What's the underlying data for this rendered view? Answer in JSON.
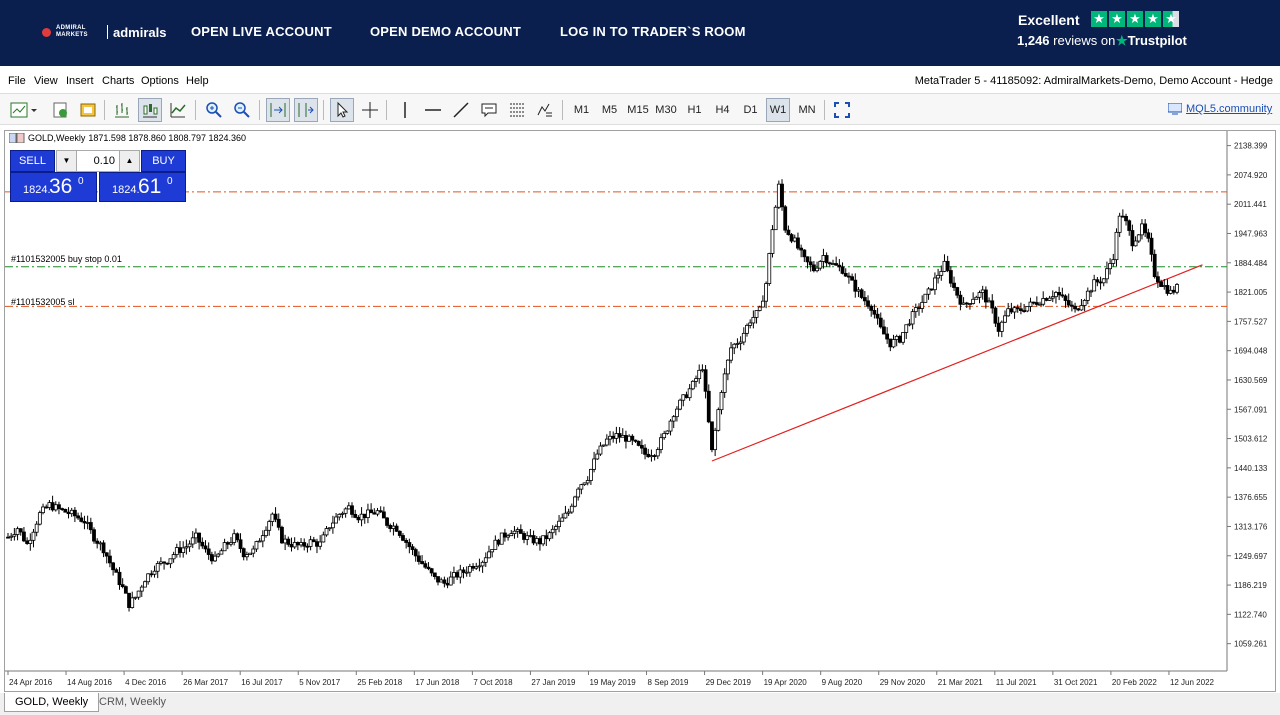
{
  "banner": {
    "logo_text_small": "ADMIRAL MARKETS",
    "logo_text": "admirals",
    "links": [
      "OPEN LIVE ACCOUNT",
      "OPEN DEMO ACCOUNT",
      "LOG IN TO TRADER`S ROOM"
    ],
    "trustpilot": {
      "rating_word": "Excellent",
      "reviews_count": "1,246",
      "reviews_word": "reviews on",
      "brand": "Trustpilot",
      "stars": 4.5
    },
    "colors": {
      "background": "#0b1f4f",
      "trustpilot_green": "#00b67a"
    }
  },
  "menu": {
    "items": [
      "File",
      "View",
      "Insert",
      "Charts",
      "Options",
      "Help"
    ],
    "window_title": "MetaTrader 5 - 41185092: AdmiralMarkets-Demo, Demo Account - Hedge"
  },
  "toolbar": {
    "timeframes": [
      "M1",
      "M5",
      "M15",
      "M30",
      "H1",
      "H4",
      "D1",
      "W1",
      "MN"
    ],
    "active_timeframe": "W1",
    "community_link": "MQL5.community"
  },
  "chart": {
    "symbol_header": "GOLD,Weekly",
    "ohlc_header": "1871.598 1878.860 1808.797 1824.360",
    "trade_panel": {
      "sell_label": "SELL",
      "buy_label": "BUY",
      "volume": "0.10",
      "sell_price_prefix": "1824.",
      "sell_price_big": "36",
      "sell_price_sup": "0",
      "buy_price_prefix": "1824.",
      "buy_price_big": "61",
      "buy_price_sup": "0"
    },
    "level_labels": {
      "buy_stop": "#1101532005 buy stop 0.01",
      "sl": "#1101532005 sl"
    }
  },
  "chart_data": {
    "type": "candlestick",
    "symbol": "GOLD",
    "timeframe": "Weekly",
    "yticks": [
      "2138.399",
      "2074.920",
      "2011.441",
      "1947.963",
      "1884.484",
      "1821.005",
      "1757.527",
      "1694.048",
      "1630.569",
      "1567.091",
      "1503.612",
      "1440.133",
      "1376.655",
      "1313.176",
      "1249.697",
      "1186.219",
      "1122.740",
      "1059.261"
    ],
    "ylim": [
      1000,
      2170
    ],
    "xticks": [
      "24 Apr 2016",
      "14 Aug 2016",
      "4 Dec 2016",
      "26 Mar 2017",
      "16 Jul 2017",
      "5 Nov 2017",
      "25 Feb 2018",
      "17 Jun 2018",
      "7 Oct 2018",
      "27 Jan 2019",
      "19 May 2019",
      "8 Sep 2019",
      "29 Dec 2019",
      "19 Apr 2020",
      "9 Aug 2020",
      "29 Nov 2020",
      "21 Mar 2021",
      "11 Jul 2021",
      "31 Oct 2021",
      "20 Feb 2022",
      "12 Jun 2022"
    ],
    "price_path": [
      [
        0,
        1290
      ],
      [
        3,
        1310
      ],
      [
        6,
        1275
      ],
      [
        10,
        1340
      ],
      [
        13,
        1360
      ],
      [
        16,
        1350
      ],
      [
        20,
        1340
      ],
      [
        24,
        1325
      ],
      [
        27,
        1290
      ],
      [
        30,
        1265
      ],
      [
        33,
        1220
      ],
      [
        36,
        1180
      ],
      [
        38,
        1145
      ],
      [
        40,
        1160
      ],
      [
        43,
        1200
      ],
      [
        46,
        1225
      ],
      [
        50,
        1240
      ],
      [
        53,
        1260
      ],
      [
        56,
        1270
      ],
      [
        59,
        1290
      ],
      [
        62,
        1260
      ],
      [
        65,
        1240
      ],
      [
        68,
        1270
      ],
      [
        71,
        1290
      ],
      [
        74,
        1255
      ],
      [
        77,
        1260
      ],
      [
        80,
        1300
      ],
      [
        83,
        1340
      ],
      [
        86,
        1285
      ],
      [
        89,
        1275
      ],
      [
        92,
        1270
      ],
      [
        95,
        1280
      ],
      [
        98,
        1275
      ],
      [
        101,
        1315
      ],
      [
        104,
        1340
      ],
      [
        107,
        1355
      ],
      [
        110,
        1335
      ],
      [
        113,
        1340
      ],
      [
        116,
        1345
      ],
      [
        119,
        1320
      ],
      [
        122,
        1310
      ],
      [
        125,
        1280
      ],
      [
        128,
        1250
      ],
      [
        131,
        1225
      ],
      [
        134,
        1200
      ],
      [
        137,
        1190
      ],
      [
        140,
        1205
      ],
      [
        143,
        1215
      ],
      [
        146,
        1230
      ],
      [
        149,
        1240
      ],
      [
        152,
        1270
      ],
      [
        155,
        1290
      ],
      [
        158,
        1305
      ],
      [
        161,
        1295
      ],
      [
        164,
        1285
      ],
      [
        167,
        1280
      ],
      [
        170,
        1295
      ],
      [
        173,
        1320
      ],
      [
        176,
        1345
      ],
      [
        179,
        1400
      ],
      [
        182,
        1420
      ],
      [
        185,
        1470
      ],
      [
        188,
        1500
      ],
      [
        191,
        1510
      ],
      [
        194,
        1505
      ],
      [
        197,
        1490
      ],
      [
        200,
        1470
      ],
      [
        203,
        1475
      ],
      [
        206,
        1510
      ],
      [
        209,
        1560
      ],
      [
        212,
        1590
      ],
      [
        215,
        1620
      ],
      [
        218,
        1660
      ],
      [
        221,
        1475
      ],
      [
        224,
        1610
      ],
      [
        227,
        1700
      ],
      [
        230,
        1720
      ],
      [
        233,
        1760
      ],
      [
        236,
        1780
      ],
      [
        238,
        1840
      ],
      [
        240,
        1960
      ],
      [
        242,
        2050
      ],
      [
        244,
        1960
      ],
      [
        247,
        1930
      ],
      [
        250,
        1890
      ],
      [
        253,
        1870
      ],
      [
        256,
        1900
      ],
      [
        259,
        1880
      ],
      [
        262,
        1870
      ],
      [
        265,
        1840
      ],
      [
        268,
        1810
      ],
      [
        271,
        1790
      ],
      [
        274,
        1740
      ],
      [
        277,
        1710
      ],
      [
        280,
        1720
      ],
      [
        283,
        1760
      ],
      [
        286,
        1790
      ],
      [
        289,
        1820
      ],
      [
        292,
        1860
      ],
      [
        294,
        1880
      ],
      [
        297,
        1830
      ],
      [
        300,
        1790
      ],
      [
        303,
        1810
      ],
      [
        306,
        1820
      ],
      [
        309,
        1780
      ],
      [
        311,
        1740
      ],
      [
        314,
        1780
      ],
      [
        317,
        1780
      ],
      [
        320,
        1790
      ],
      [
        323,
        1800
      ],
      [
        326,
        1810
      ],
      [
        329,
        1820
      ],
      [
        332,
        1800
      ],
      [
        335,
        1780
      ],
      [
        338,
        1810
      ],
      [
        341,
        1840
      ],
      [
        344,
        1850
      ],
      [
        347,
        1900
      ],
      [
        349,
        1990
      ],
      [
        351,
        1970
      ],
      [
        353,
        1930
      ],
      [
        356,
        1960
      ],
      [
        358,
        1930
      ],
      [
        360,
        1860
      ],
      [
        362,
        1840
      ],
      [
        365,
        1820
      ],
      [
        367,
        1830
      ]
    ],
    "levels": [
      {
        "label": "#1101532005 sl",
        "price": 1790,
        "color": "#e5541c"
      },
      {
        "label": "#1101532005 buy stop 0.01",
        "price": 1876,
        "color": "#1e8b2a"
      },
      {
        "price": 2038,
        "color": "#e5541c"
      }
    ],
    "trendline": {
      "from": [
        221,
        1455
      ],
      "to": [
        375,
        1880
      ],
      "color": "#e02020"
    },
    "grid": false
  },
  "tabs": [
    "GOLD, Weekly",
    "CRM, Weekly"
  ],
  "active_tab": 0
}
